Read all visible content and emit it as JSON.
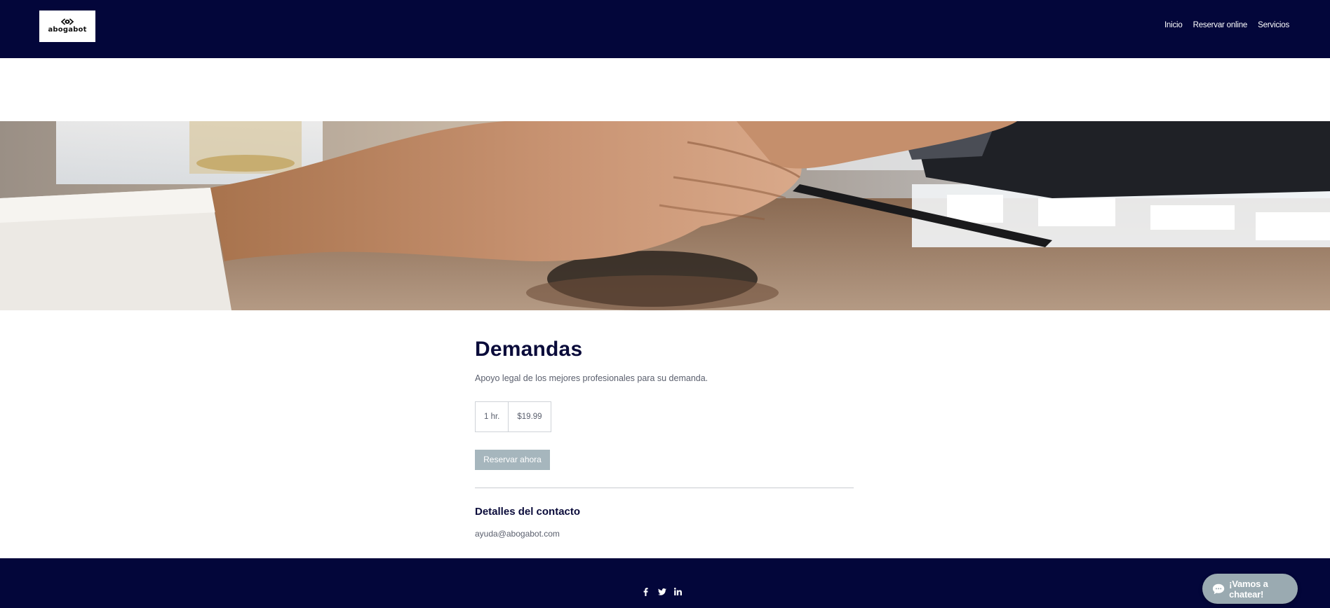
{
  "header": {
    "logo_text": "abogabot",
    "nav": [
      {
        "label": "Inicio"
      },
      {
        "label": "Reservar online"
      },
      {
        "label": "Servicios"
      }
    ]
  },
  "hero": {
    "image": "handshake-photo"
  },
  "service": {
    "title": "Demandas",
    "description": "Apoyo legal de los mejores profesionales para su demanda.",
    "duration": "1 hr.",
    "price": "$19.99",
    "book_label": "Reservar ahora"
  },
  "contact": {
    "heading": "Detalles del contacto",
    "email": "ayuda@abogabot.com"
  },
  "footer": {
    "social": [
      "facebook-icon",
      "twitter-icon",
      "linkedin-icon"
    ]
  },
  "chat": {
    "label": "¡Vamos a chatear!"
  },
  "colors": {
    "header_bg": "#03063a",
    "button_bg": "#a6b6bd",
    "chat_bg": "#9aaab1",
    "title": "#0a0b3a"
  }
}
